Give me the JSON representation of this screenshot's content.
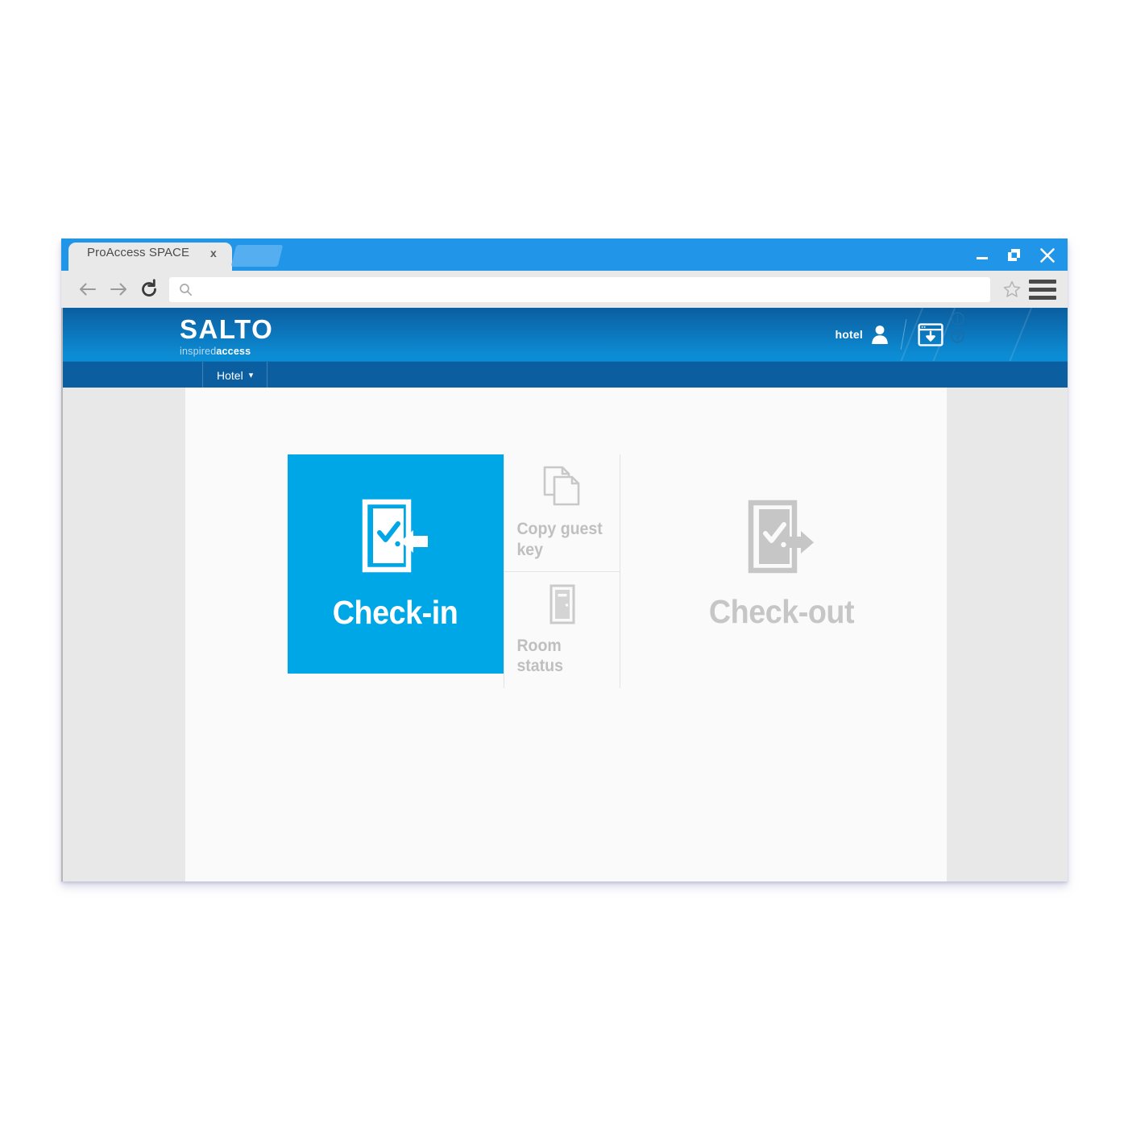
{
  "browser": {
    "tab": {
      "title": "ProAccess SPACE",
      "close_label": "x"
    },
    "new_tab_label": "new-tab",
    "address": {
      "value": "",
      "placeholder": ""
    },
    "controls": {
      "back": "back",
      "forward": "forward",
      "reload": "reload",
      "bookmark": "bookmark",
      "menu": "menu",
      "minimize": "minimize",
      "maximize": "maximize",
      "close": "close"
    }
  },
  "app": {
    "logo": {
      "wordmark": "SALTO",
      "tagline_light": "inspired",
      "tagline_bold": "access"
    },
    "header": {
      "user_label": "hotel",
      "user_icon": "user-icon",
      "download_icon": "download-icon",
      "info_badge": "info-icon",
      "help_badge": "help-icon"
    },
    "nav": {
      "items": [
        {
          "label": "Hotel",
          "caret": "▾"
        }
      ]
    }
  },
  "main": {
    "tiles": {
      "primary": {
        "label": "Check-in",
        "icon": "door-check-in-icon",
        "color": "#00a7e7",
        "state": "active"
      },
      "secondary": [
        {
          "label": "Copy guest key",
          "icon": "copy-documents-icon",
          "state": "disabled"
        },
        {
          "label": "Room status",
          "icon": "door-icon",
          "state": "disabled"
        }
      ],
      "checkout": {
        "label": "Check-out",
        "icon": "door-check-out-icon",
        "color": "#c6c6c6",
        "state": "disabled"
      }
    }
  },
  "colors": {
    "brand_cyan": "#00a7e7",
    "brand_blue_dark": "#0b5e9f",
    "brand_blue_light": "#0b8ed6",
    "tab_strip": "#2196e8",
    "page_bg": "#e8e8e8",
    "panel_bg": "#fafafa",
    "disabled_gray": "#c6c6c6"
  }
}
